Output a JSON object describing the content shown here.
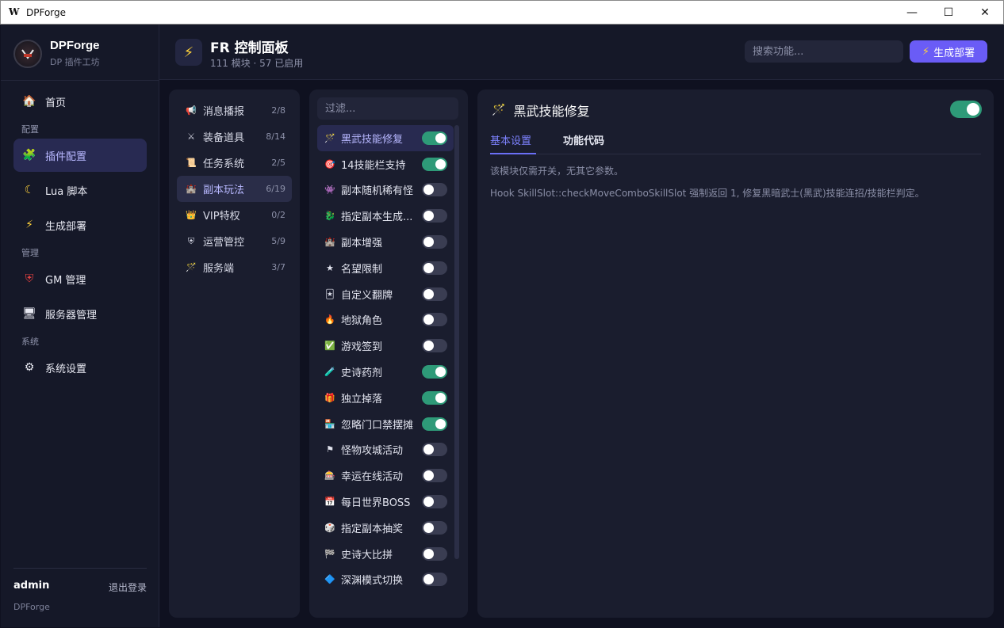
{
  "window": {
    "title": "DPForge",
    "app_icon": "W",
    "minimize": "—",
    "maximize": "☐",
    "close": "✕"
  },
  "sidebar": {
    "brand_name": "DPForge",
    "brand_sub": "DP 插件工坊",
    "sections": {
      "config": "配置",
      "manage": "管理",
      "system": "系统"
    },
    "items": {
      "home": {
        "label": "首页",
        "icon": "home-icon"
      },
      "plugin": {
        "label": "插件配置",
        "icon": "puzzle-icon"
      },
      "lua": {
        "label": "Lua 脚本",
        "icon": "moon-icon"
      },
      "deploy": {
        "label": "生成部署",
        "icon": "bolt-icon"
      },
      "gm": {
        "label": "GM 管理",
        "icon": "shield-icon"
      },
      "server": {
        "label": "服务器管理",
        "icon": "monitor-icon"
      },
      "settings": {
        "label": "系统设置",
        "icon": "gear-icon"
      }
    },
    "user": "admin",
    "logout": "退出登录",
    "footer": "DPForge"
  },
  "header": {
    "title": "FR 控制面板",
    "subtitle": "111 模块 · 57 已启用",
    "search_placeholder": "搜索功能...",
    "deploy_button": "生成部署"
  },
  "categories": [
    {
      "label": "消息播报",
      "count": "2/8",
      "icon": "megaphone-icon"
    },
    {
      "label": "装备道具",
      "count": "8/14",
      "icon": "crossed-swords-icon"
    },
    {
      "label": "任务系统",
      "count": "2/5",
      "icon": "scroll-icon"
    },
    {
      "label": "副本玩法",
      "count": "6/19",
      "icon": "castle-icon"
    },
    {
      "label": "VIP特权",
      "count": "0/2",
      "icon": "crown-icon"
    },
    {
      "label": "运营管控",
      "count": "5/9",
      "icon": "shield-icon"
    },
    {
      "label": "服务端",
      "count": "3/7",
      "icon": "wand-icon"
    }
  ],
  "filter_placeholder": "过滤...",
  "modules": [
    {
      "label": "黑武技能修复",
      "on": true,
      "icon": "wand-icon"
    },
    {
      "label": "14技能栏支持",
      "on": true,
      "icon": "target-icon"
    },
    {
      "label": "副本随机稀有怪",
      "on": false,
      "icon": "monster-icon"
    },
    {
      "label": "指定副本生成...",
      "on": false,
      "icon": "dragon-icon"
    },
    {
      "label": "副本增强",
      "on": false,
      "icon": "castle-icon"
    },
    {
      "label": "名望限制",
      "on": false,
      "icon": "star-icon"
    },
    {
      "label": "自定义翻牌",
      "on": false,
      "icon": "card-icon"
    },
    {
      "label": "地狱角色",
      "on": false,
      "icon": "fire-icon"
    },
    {
      "label": "游戏签到",
      "on": false,
      "icon": "check-icon"
    },
    {
      "label": "史诗药剂",
      "on": true,
      "icon": "potion-icon"
    },
    {
      "label": "独立掉落",
      "on": true,
      "icon": "gift-icon"
    },
    {
      "label": "忽略门口禁摆摊",
      "on": true,
      "icon": "shop-icon"
    },
    {
      "label": "怪物攻城活动",
      "on": false,
      "icon": "siege-icon"
    },
    {
      "label": "幸运在线活动",
      "on": false,
      "icon": "slot-icon"
    },
    {
      "label": "每日世界BOSS",
      "on": false,
      "icon": "calendar-icon"
    },
    {
      "label": "指定副本抽奖",
      "on": false,
      "icon": "dice-icon"
    },
    {
      "label": "史诗大比拼",
      "on": false,
      "icon": "flag-icon"
    },
    {
      "label": "深渊模式切换",
      "on": false,
      "icon": "diamond-icon"
    }
  ],
  "detail": {
    "title": "黑武技能修复",
    "icon": "wand-icon",
    "enabled": true,
    "tabs": [
      "基本设置",
      "功能代码"
    ],
    "line1": "该模块仅需开关，无其它参数。",
    "line2": "Hook SkillSlot::checkMoveComboSkillSlot 强制返回 1, 修复黑暗武士(黑武)技能连招/技能栏判定。"
  },
  "colors": {
    "accent": "#6a5cf6",
    "toggle_on": "#2e9a78",
    "active_bg": "#282a50"
  }
}
